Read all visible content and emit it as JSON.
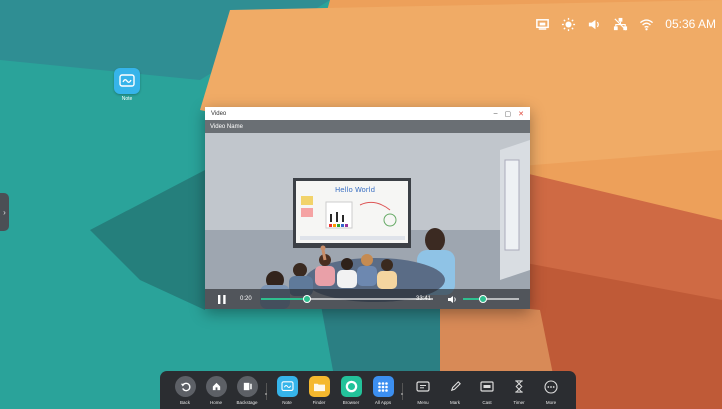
{
  "status_bar": {
    "time": "05:36 AM",
    "icons": [
      "screen-mirror-icon",
      "brightness-icon",
      "volume-icon",
      "ethernet-disconnected-icon",
      "wifi-icon"
    ]
  },
  "desktop": {
    "apps": [
      {
        "label": "Note",
        "icon": "note-app-icon"
      }
    ]
  },
  "video_window": {
    "title": "Video",
    "video_name": "Video Name",
    "window_controls": [
      "minimize",
      "maximize",
      "close"
    ],
    "current_time": "0:20",
    "total_time": "33:41",
    "progress": 0.27,
    "volume": 0.35,
    "whiteboard_text": "Hello World"
  },
  "dock": {
    "system": [
      {
        "label": "Back",
        "icon": "back-icon"
      },
      {
        "label": "Home",
        "icon": "home-icon"
      },
      {
        "label": "Backstage",
        "icon": "backstage-icon"
      }
    ],
    "apps": [
      {
        "label": "Note",
        "icon": "note-app-icon",
        "color": "#36b4ea"
      },
      {
        "label": "Finder",
        "icon": "finder-folder-icon",
        "color": "#f5b82e"
      },
      {
        "label": "Browser",
        "icon": "browser-icon",
        "color": "#23c29a"
      },
      {
        "label": "All Apps",
        "icon": "all-apps-grid-icon",
        "color": "#3c8ff0"
      }
    ],
    "tools": [
      {
        "label": "Menu",
        "icon": "menu-icon"
      },
      {
        "label": "Mark",
        "icon": "pen-mark-icon"
      },
      {
        "label": "Cast",
        "icon": "cast-icon"
      },
      {
        "label": "Timer",
        "icon": "hourglass-timer-icon"
      },
      {
        "label": "More",
        "icon": "more-dots-icon"
      }
    ]
  },
  "colors": {
    "wallpaper_teal": "#2aa39a",
    "wallpaper_orange": "#eea25c",
    "wallpaper_rust": "#c8623f",
    "accent_green": "#2fbf8f"
  }
}
